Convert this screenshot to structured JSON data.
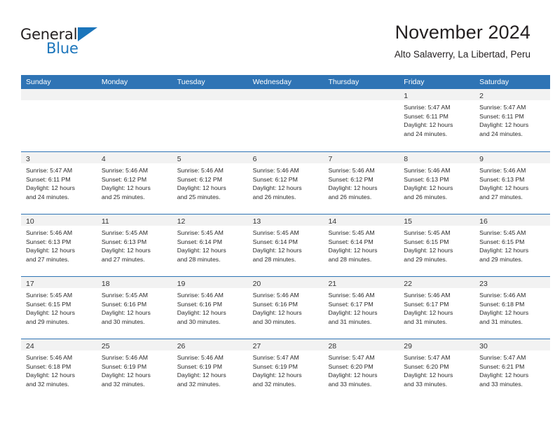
{
  "brand": {
    "word1": "General",
    "word2": "Blue",
    "flag_icon": "blue-triangle-flag"
  },
  "header": {
    "title": "November 2024",
    "subtitle": "Alto Salaverry, La Libertad, Peru"
  },
  "colors": {
    "header_blue": "#2f74b5",
    "brand_blue": "#1b75bb",
    "daynum_band": "#f2f2f2",
    "text": "#231f20"
  },
  "calendar": {
    "weekdays": [
      "Sunday",
      "Monday",
      "Tuesday",
      "Wednesday",
      "Thursday",
      "Friday",
      "Saturday"
    ],
    "weeks": [
      [
        {
          "day": "",
          "lines": []
        },
        {
          "day": "",
          "lines": []
        },
        {
          "day": "",
          "lines": []
        },
        {
          "day": "",
          "lines": []
        },
        {
          "day": "",
          "lines": []
        },
        {
          "day": "1",
          "lines": [
            "Sunrise: 5:47 AM",
            "Sunset: 6:11 PM",
            "Daylight: 12 hours",
            "and 24 minutes."
          ]
        },
        {
          "day": "2",
          "lines": [
            "Sunrise: 5:47 AM",
            "Sunset: 6:11 PM",
            "Daylight: 12 hours",
            "and 24 minutes."
          ]
        }
      ],
      [
        {
          "day": "3",
          "lines": [
            "Sunrise: 5:47 AM",
            "Sunset: 6:11 PM",
            "Daylight: 12 hours",
            "and 24 minutes."
          ]
        },
        {
          "day": "4",
          "lines": [
            "Sunrise: 5:46 AM",
            "Sunset: 6:12 PM",
            "Daylight: 12 hours",
            "and 25 minutes."
          ]
        },
        {
          "day": "5",
          "lines": [
            "Sunrise: 5:46 AM",
            "Sunset: 6:12 PM",
            "Daylight: 12 hours",
            "and 25 minutes."
          ]
        },
        {
          "day": "6",
          "lines": [
            "Sunrise: 5:46 AM",
            "Sunset: 6:12 PM",
            "Daylight: 12 hours",
            "and 26 minutes."
          ]
        },
        {
          "day": "7",
          "lines": [
            "Sunrise: 5:46 AM",
            "Sunset: 6:12 PM",
            "Daylight: 12 hours",
            "and 26 minutes."
          ]
        },
        {
          "day": "8",
          "lines": [
            "Sunrise: 5:46 AM",
            "Sunset: 6:13 PM",
            "Daylight: 12 hours",
            "and 26 minutes."
          ]
        },
        {
          "day": "9",
          "lines": [
            "Sunrise: 5:46 AM",
            "Sunset: 6:13 PM",
            "Daylight: 12 hours",
            "and 27 minutes."
          ]
        }
      ],
      [
        {
          "day": "10",
          "lines": [
            "Sunrise: 5:46 AM",
            "Sunset: 6:13 PM",
            "Daylight: 12 hours",
            "and 27 minutes."
          ]
        },
        {
          "day": "11",
          "lines": [
            "Sunrise: 5:45 AM",
            "Sunset: 6:13 PM",
            "Daylight: 12 hours",
            "and 27 minutes."
          ]
        },
        {
          "day": "12",
          "lines": [
            "Sunrise: 5:45 AM",
            "Sunset: 6:14 PM",
            "Daylight: 12 hours",
            "and 28 minutes."
          ]
        },
        {
          "day": "13",
          "lines": [
            "Sunrise: 5:45 AM",
            "Sunset: 6:14 PM",
            "Daylight: 12 hours",
            "and 28 minutes."
          ]
        },
        {
          "day": "14",
          "lines": [
            "Sunrise: 5:45 AM",
            "Sunset: 6:14 PM",
            "Daylight: 12 hours",
            "and 28 minutes."
          ]
        },
        {
          "day": "15",
          "lines": [
            "Sunrise: 5:45 AM",
            "Sunset: 6:15 PM",
            "Daylight: 12 hours",
            "and 29 minutes."
          ]
        },
        {
          "day": "16",
          "lines": [
            "Sunrise: 5:45 AM",
            "Sunset: 6:15 PM",
            "Daylight: 12 hours",
            "and 29 minutes."
          ]
        }
      ],
      [
        {
          "day": "17",
          "lines": [
            "Sunrise: 5:45 AM",
            "Sunset: 6:15 PM",
            "Daylight: 12 hours",
            "and 29 minutes."
          ]
        },
        {
          "day": "18",
          "lines": [
            "Sunrise: 5:45 AM",
            "Sunset: 6:16 PM",
            "Daylight: 12 hours",
            "and 30 minutes."
          ]
        },
        {
          "day": "19",
          "lines": [
            "Sunrise: 5:46 AM",
            "Sunset: 6:16 PM",
            "Daylight: 12 hours",
            "and 30 minutes."
          ]
        },
        {
          "day": "20",
          "lines": [
            "Sunrise: 5:46 AM",
            "Sunset: 6:16 PM",
            "Daylight: 12 hours",
            "and 30 minutes."
          ]
        },
        {
          "day": "21",
          "lines": [
            "Sunrise: 5:46 AM",
            "Sunset: 6:17 PM",
            "Daylight: 12 hours",
            "and 31 minutes."
          ]
        },
        {
          "day": "22",
          "lines": [
            "Sunrise: 5:46 AM",
            "Sunset: 6:17 PM",
            "Daylight: 12 hours",
            "and 31 minutes."
          ]
        },
        {
          "day": "23",
          "lines": [
            "Sunrise: 5:46 AM",
            "Sunset: 6:18 PM",
            "Daylight: 12 hours",
            "and 31 minutes."
          ]
        }
      ],
      [
        {
          "day": "24",
          "lines": [
            "Sunrise: 5:46 AM",
            "Sunset: 6:18 PM",
            "Daylight: 12 hours",
            "and 32 minutes."
          ]
        },
        {
          "day": "25",
          "lines": [
            "Sunrise: 5:46 AM",
            "Sunset: 6:19 PM",
            "Daylight: 12 hours",
            "and 32 minutes."
          ]
        },
        {
          "day": "26",
          "lines": [
            "Sunrise: 5:46 AM",
            "Sunset: 6:19 PM",
            "Daylight: 12 hours",
            "and 32 minutes."
          ]
        },
        {
          "day": "27",
          "lines": [
            "Sunrise: 5:47 AM",
            "Sunset: 6:19 PM",
            "Daylight: 12 hours",
            "and 32 minutes."
          ]
        },
        {
          "day": "28",
          "lines": [
            "Sunrise: 5:47 AM",
            "Sunset: 6:20 PM",
            "Daylight: 12 hours",
            "and 33 minutes."
          ]
        },
        {
          "day": "29",
          "lines": [
            "Sunrise: 5:47 AM",
            "Sunset: 6:20 PM",
            "Daylight: 12 hours",
            "and 33 minutes."
          ]
        },
        {
          "day": "30",
          "lines": [
            "Sunrise: 5:47 AM",
            "Sunset: 6:21 PM",
            "Daylight: 12 hours",
            "and 33 minutes."
          ]
        }
      ]
    ]
  }
}
